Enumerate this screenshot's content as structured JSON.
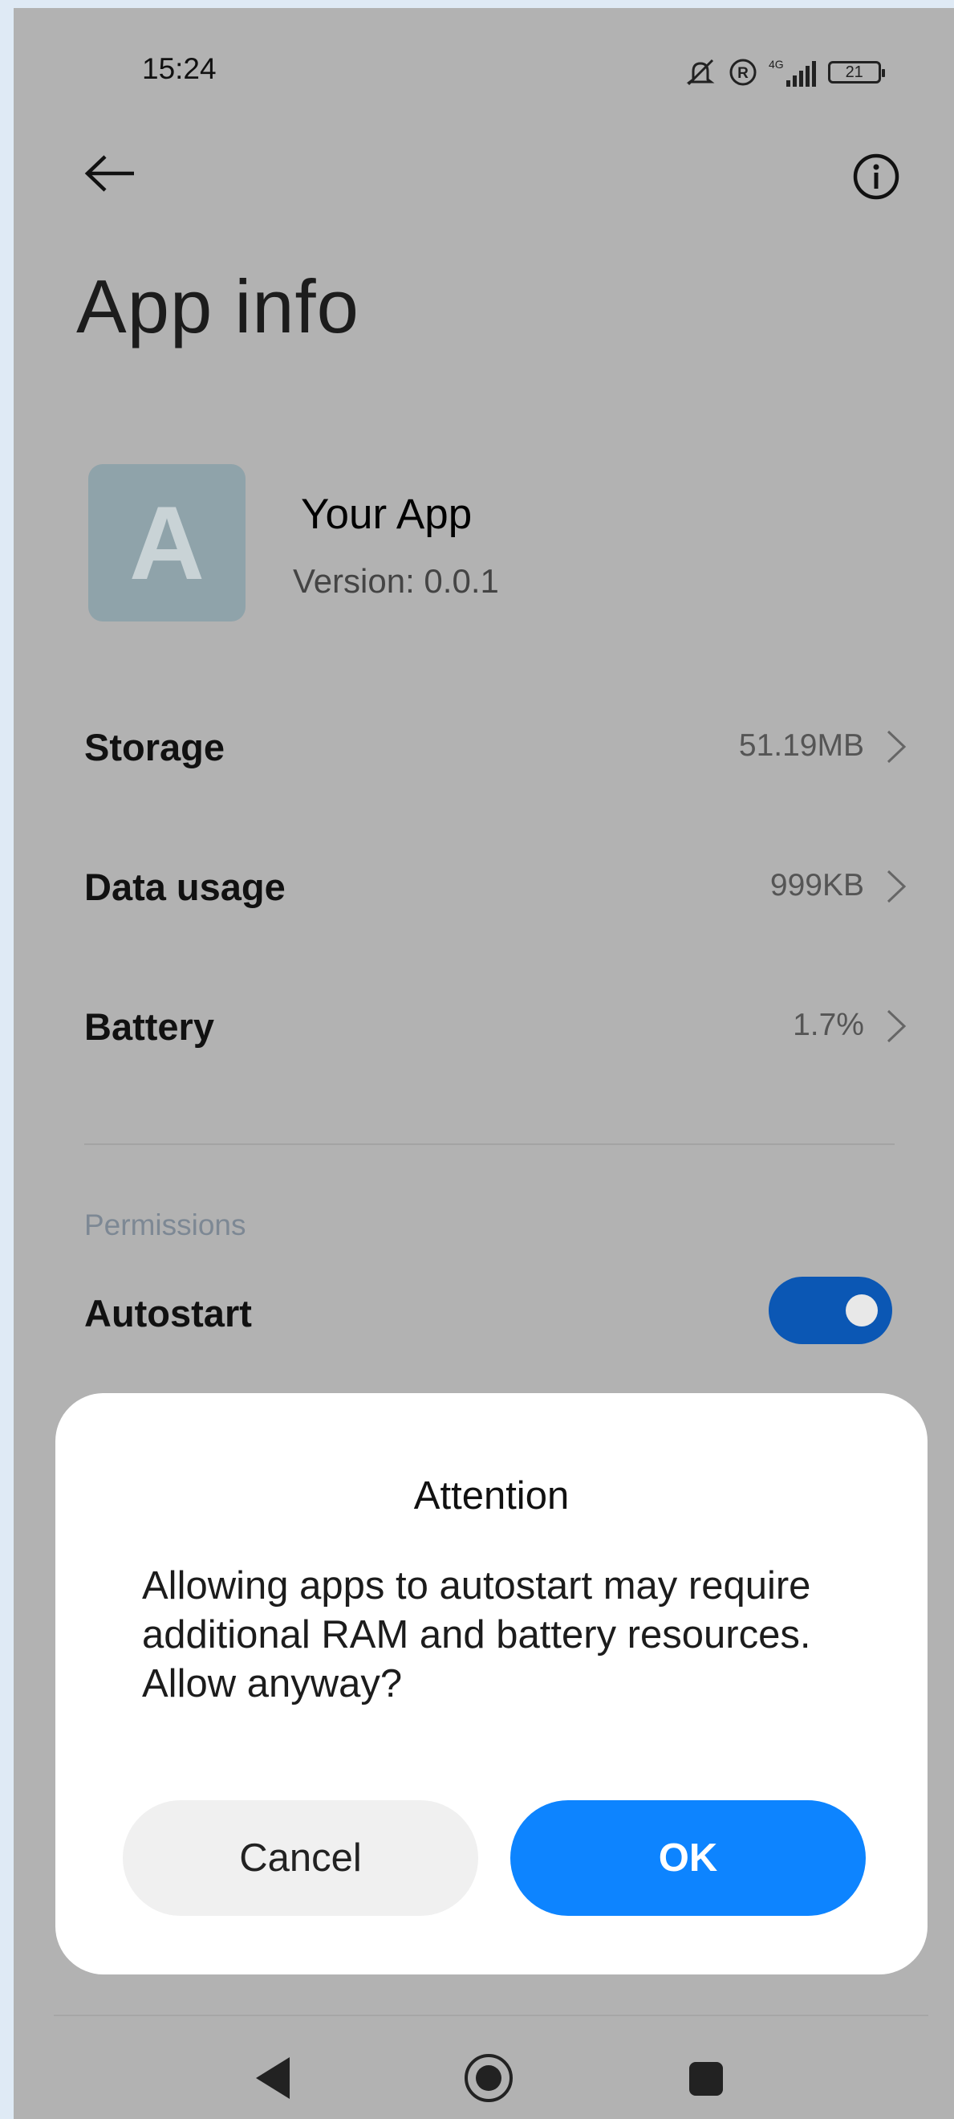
{
  "status_bar": {
    "time": "15:24",
    "network_label": "4G",
    "battery": "21"
  },
  "header": {
    "back_icon": "arrow-left-icon",
    "info_icon": "info-circle-icon",
    "title": "App info"
  },
  "app": {
    "icon_letter": "A",
    "name": "Your App",
    "version": "Version: 0.0.1"
  },
  "rows": [
    {
      "label": "Storage",
      "value": "51.19MB"
    },
    {
      "label": "Data usage",
      "value": "999KB"
    },
    {
      "label": "Battery",
      "value": "1.7%"
    }
  ],
  "permissions": {
    "section_label": "Permissions",
    "autostart_label": "Autostart",
    "autostart_on": true
  },
  "dialog": {
    "title": "Attention",
    "message": "Allowing apps to autostart may require additional RAM and battery resources. Allow anyway?",
    "cancel_label": "Cancel",
    "ok_label": "OK"
  },
  "colors": {
    "accent": "#0d84ff",
    "toggle": "#0b57b4",
    "scrim_background": "#b2b2b2"
  }
}
